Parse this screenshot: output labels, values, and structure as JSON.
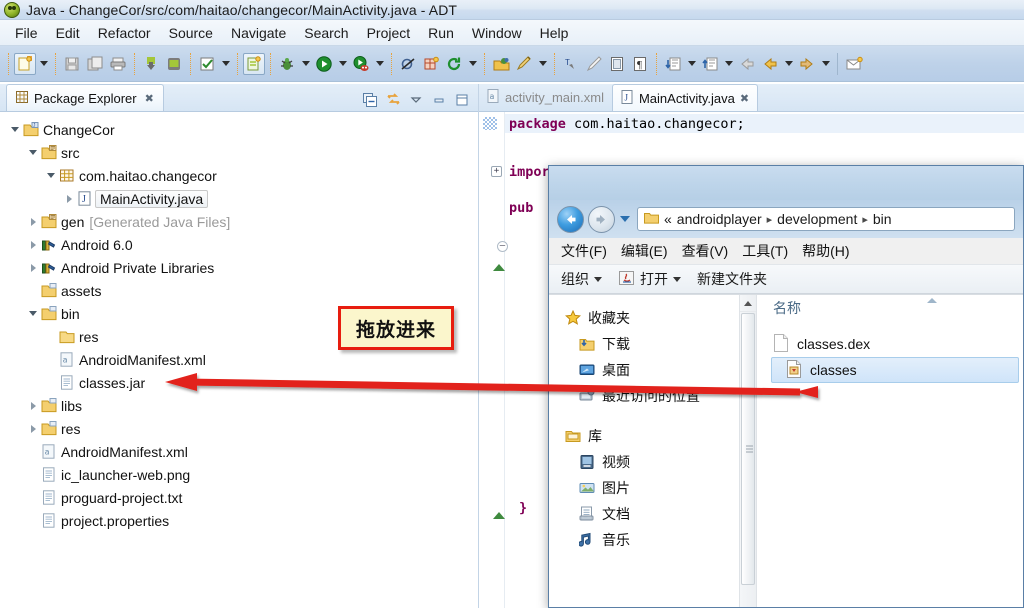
{
  "window": {
    "title": "Java - ChangeCor/src/com/haitao/changecor/MainActivity.java - ADT",
    "app_icon": "android-head-icon"
  },
  "menubar": {
    "items": [
      "File",
      "Edit",
      "Refactor",
      "Source",
      "Navigate",
      "Search",
      "Project",
      "Run",
      "Window",
      "Help"
    ]
  },
  "toolbar": {
    "icons": [
      "new-wizard-icon",
      "save-icon",
      "save-all-icon",
      "print-icon",
      "android-sdk-manager-icon",
      "android-avd-manager-icon",
      "check-icon",
      "new-android-project-icon",
      "debug-icon",
      "run-icon",
      "run-coverage-icon",
      "skip-breakpoints-icon",
      "new-class-icon",
      "refresh-icon",
      "open-type-icon",
      "annotate-icon",
      "toggle-mark-icon",
      "show-whitespace-icon",
      "next-annotation-icon",
      "previous-annotation-icon",
      "back-icon",
      "forward-icon",
      "new-email-icon"
    ]
  },
  "package_explorer": {
    "tab_label": "Package Explorer",
    "close_glyph": "✖",
    "actions": [
      "collapse-all-icon",
      "link-with-editor-icon",
      "view-menu-icon",
      "minimize-icon",
      "maximize-icon"
    ],
    "tree": [
      {
        "label": "ChangeCor",
        "indent": 0,
        "expander": "open",
        "icon": "java-project-icon",
        "dim": ""
      },
      {
        "label": "src",
        "indent": 1,
        "expander": "open",
        "icon": "source-folder-icon",
        "dim": ""
      },
      {
        "label": "com.haitao.changecor",
        "indent": 2,
        "expander": "open",
        "icon": "package-icon",
        "dim": ""
      },
      {
        "label": "MainActivity.java",
        "indent": 3,
        "expander": "closed",
        "icon": "java-file-icon",
        "dim": "",
        "selected": true
      },
      {
        "label": "gen",
        "indent": 1,
        "expander": "closed",
        "icon": "source-folder-icon",
        "dim": "[Generated Java Files]"
      },
      {
        "label": "Android 6.0",
        "indent": 1,
        "expander": "closed",
        "icon": "library-icon",
        "dim": ""
      },
      {
        "label": "Android Private Libraries",
        "indent": 1,
        "expander": "closed",
        "icon": "library-icon",
        "dim": ""
      },
      {
        "label": "assets",
        "indent": 1,
        "expander": "none",
        "icon": "folder-icon",
        "dim": ""
      },
      {
        "label": "bin",
        "indent": 1,
        "expander": "open",
        "icon": "folder-icon",
        "dim": ""
      },
      {
        "label": "res",
        "indent": 2,
        "expander": "none",
        "icon": "plain-folder-icon",
        "dim": ""
      },
      {
        "label": "AndroidManifest.xml",
        "indent": 2,
        "expander": "none",
        "icon": "xml-file-icon",
        "dim": ""
      },
      {
        "label": "classes.jar",
        "indent": 2,
        "expander": "none",
        "icon": "file-icon",
        "dim": ""
      },
      {
        "label": "libs",
        "indent": 1,
        "expander": "closed",
        "icon": "folder-icon",
        "dim": ""
      },
      {
        "label": "res",
        "indent": 1,
        "expander": "closed",
        "icon": "folder-icon",
        "dim": ""
      },
      {
        "label": "AndroidManifest.xml",
        "indent": 1,
        "expander": "none",
        "icon": "xml-file-icon",
        "dim": ""
      },
      {
        "label": "ic_launcher-web.png",
        "indent": 1,
        "expander": "none",
        "icon": "file-icon",
        "dim": ""
      },
      {
        "label": "proguard-project.txt",
        "indent": 1,
        "expander": "none",
        "icon": "file-icon",
        "dim": ""
      },
      {
        "label": "project.properties",
        "indent": 1,
        "expander": "none",
        "icon": "file-icon",
        "dim": ""
      }
    ]
  },
  "editor": {
    "tabs": [
      {
        "label": "activity_main.xml",
        "icon": "xml-file-icon",
        "active": false,
        "closable": false
      },
      {
        "label": "MainActivity.java",
        "icon": "java-file-icon",
        "active": true,
        "closable": true,
        "close_glyph": "✖"
      }
    ],
    "code": {
      "line1_keyword": "package",
      "line1_rest": " com.haitao.changecor;",
      "line2_keyword": "import",
      "line3_keyword": "pub",
      "closing_brace": "}"
    }
  },
  "explorer_window": {
    "nav": {
      "back_icon": "back-arrow-icon",
      "forward_icon": "forward-arrow-icon",
      "history_icon": "recent-pages-icon",
      "folder_icon": "folder-icon",
      "overflow": "«",
      "breadcrumbs": [
        "androidplayer",
        "development",
        "bin"
      ],
      "separator": "▸"
    },
    "menu": [
      "文件(F)",
      "编辑(E)",
      "查看(V)",
      "工具(T)",
      "帮助(H)"
    ],
    "commands": [
      {
        "label": "组织",
        "caret": true,
        "icon": ""
      },
      {
        "label": "打开",
        "caret": true,
        "icon": "java-jar-icon"
      },
      {
        "label": "新建文件夹",
        "caret": false,
        "icon": ""
      }
    ],
    "navpane": [
      {
        "label": "收藏夹",
        "icon": "star-icon",
        "level": 0
      },
      {
        "label": "下载",
        "icon": "downloads-icon",
        "level": 1
      },
      {
        "label": "桌面",
        "icon": "desktop-icon",
        "level": 1
      },
      {
        "label": "最近访问的位置",
        "icon": "recent-places-icon",
        "level": 1
      },
      {
        "label": "",
        "icon": "",
        "level": 0
      },
      {
        "label": "库",
        "icon": "library-folder-icon",
        "level": 0
      },
      {
        "label": "视频",
        "icon": "videos-icon",
        "level": 1
      },
      {
        "label": "图片",
        "icon": "pictures-icon",
        "level": 1
      },
      {
        "label": "文档",
        "icon": "documents-icon",
        "level": 1
      },
      {
        "label": "音乐",
        "icon": "music-icon",
        "level": 1
      }
    ],
    "file_list": {
      "column_header": "名称",
      "items": [
        {
          "name": "classes.dex",
          "icon": "blank-file-icon",
          "selected": false
        },
        {
          "name": "classes",
          "icon": "jar-file-icon",
          "selected": true
        }
      ]
    }
  },
  "annotation": {
    "box_text": "拖放进来",
    "box_fill": "#fbf6cc",
    "box_border": "#e71d0f",
    "arrow_color": "#e2231a"
  }
}
